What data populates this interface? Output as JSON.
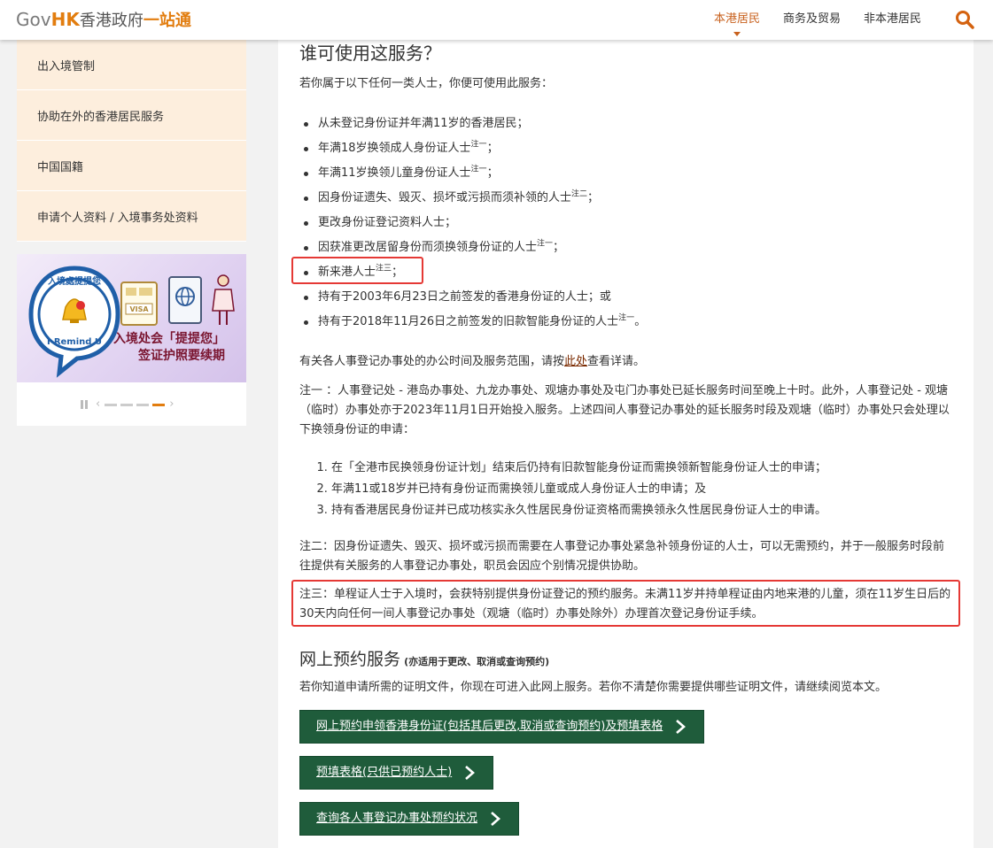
{
  "header": {
    "logo_gov": "Gov",
    "logo_hk": "HK",
    "logo_cn": "香港政府",
    "logo_one": "一站通",
    "nav": [
      "本港居民",
      "商务及贸易",
      "非本港居民"
    ]
  },
  "sidebar": {
    "items": [
      "出入境管制",
      "协助在外的香港居民服务",
      "中国国籍",
      "申请个人资料 / 入境事务处资料"
    ]
  },
  "banner": {
    "line1": "入境处会「提提您」",
    "line2": "签证护照要续期",
    "badge_top": "入境處提提您",
    "badge_bottom": "I-Remind U",
    "visa": "VISA"
  },
  "main": {
    "title": "谁可使用这服务？",
    "intro": "若你属于以下任何一类人士，你便可使用此服务：",
    "bullets": [
      {
        "text": "从未登记身份证并年满11岁的香港居民；",
        "note": "",
        "tail": ""
      },
      {
        "text": "年满18岁换领成人身份证人士",
        "note": "注一",
        "tail": "；"
      },
      {
        "text": "年满11岁换领儿童身份证人士",
        "note": "注一",
        "tail": "；"
      },
      {
        "text": "因身份证遗失、毁灭、损坏或污损而须补领的人士",
        "note": "注二",
        "tail": "；"
      },
      {
        "text": "更改身份证登记资料人士；",
        "note": "",
        "tail": ""
      },
      {
        "text": "因获准更改居留身份而须换领身份证的人士",
        "note": "注一",
        "tail": "；"
      },
      {
        "text": "新来港人士",
        "note": "注三",
        "tail": "；"
      },
      {
        "text": "持有于2003年6月23日之前签发的香港身份证的人士；或",
        "note": "",
        "tail": ""
      },
      {
        "text": "持有于2018年11月26日之前签发的旧款智能身份证的人士",
        "note": "注一",
        "tail": "。"
      }
    ],
    "office_pre": "有关各人事登记办事处的办公时间及服务范围，请按",
    "office_link": "此处",
    "office_post": "查看详请。",
    "note1": "注一 ：人事登记处 - 港岛办事处、九龙办事处、观塘办事处及屯门办事处已延长服务时间至晚上十时。此外，人事登记处 - 观塘（临时）办事处亦于2023年11月1日开始投入服务。上述四间人事登记办事处的延长服务时段及观塘（临时）办事处只会处理以下换领身份证的申请：",
    "note1_items": [
      "在「全港市民换领身份证计划」结束后仍持有旧款智能身份证而需换领新智能身份证人士的申请；",
      "年满11或18岁并已持有身份证而需换领儿童或成人身份证人士的申请；及",
      "持有香港居民身份证并已成功核实永久性居民身份证资格而需换领永久性居民身份证人士的申请。"
    ],
    "note2": "注二：因身份证遗失、毁灭、损坏或污损而需要在人事登记办事处紧急补领身份证的人士，可以无需预约，并于一般服务时段前往提供有关服务的人事登记办事处，职员会因应个别情况提供协助。",
    "note3": "注三：单程证人士于入境时，会获特别提供身份证登记的预约服务。未满11岁并持单程证由内地来港的儿童，须在11岁生日后的30天内向任何一间人事登记办事处（观塘（临时）办事处除外）办理首次登记身份证手续。",
    "online_title": "网上预约服务",
    "online_sub": "(亦适用于更改、取消或查询预约)",
    "online_intro": "若你知道申请所需的证明文件，你现在可进入此网上服务。若你不清楚你需要提供哪些证明文件，请继续阅览本文。",
    "buttons": [
      "网上预约申领香港身份证(包括其后更改,取消或查询预约)及预填表格",
      "预填表格(只供已预约人士)",
      "查询各人事登记办事处预约状况"
    ]
  }
}
